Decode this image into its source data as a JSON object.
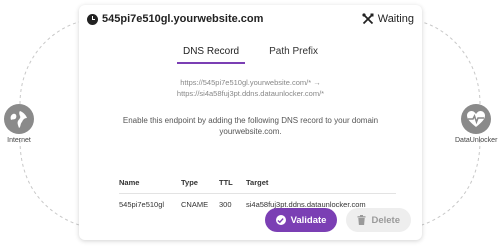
{
  "nodes": {
    "internet": {
      "label": "Internet"
    },
    "dataunlocker": {
      "label": "DataUnlocker"
    }
  },
  "card": {
    "hostname": "545pi7e510gl.yourwebsite.com",
    "status": "Waiting",
    "tabs": [
      {
        "label": "DNS Record",
        "active": true
      },
      {
        "label": "Path Prefix",
        "active": false
      }
    ],
    "redirect_line1": "https://545pi7e510gl.yourwebsite.com/* →",
    "redirect_line2": "https://si4a58fuj3pt.ddns.dataunlocker.com/*",
    "info_text": "Enable this endpoint by adding the following DNS record to your domain yourwebsite.com.",
    "table": {
      "headers": [
        "Name",
        "Type",
        "TTL",
        "Target"
      ],
      "rows": [
        [
          "545pi7e510gl",
          "CNAME",
          "300",
          "si4a58fuj3pt.ddns.dataunlocker.com"
        ]
      ]
    },
    "buttons": {
      "validate": "Validate",
      "delete": "Delete"
    }
  },
  "colors": {
    "accent": "#7b3fb4",
    "node_gray": "#8a8a8a",
    "delete_bg": "#eeeeee"
  }
}
